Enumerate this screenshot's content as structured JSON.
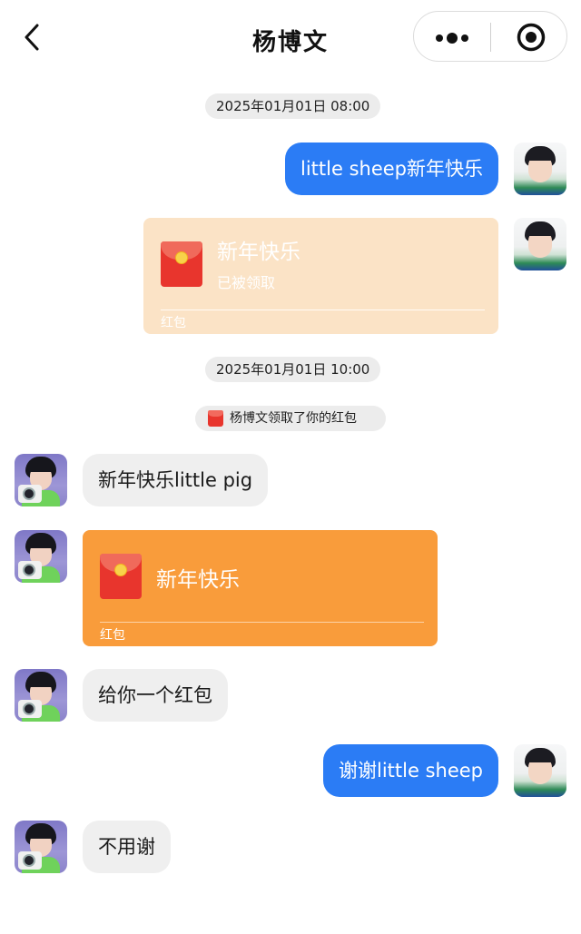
{
  "header": {
    "title": "杨博文",
    "back_icon": "chevron-left-icon",
    "more_icon": "more-dots-icon",
    "close_icon": "target-circle-icon"
  },
  "colors": {
    "outgoing_bubble": "#2b7cf5",
    "incoming_bubble": "#efefef",
    "packet_received": "#fbe3c6",
    "packet_unopened": "#f99c3b",
    "envelope_red": "#e8352d"
  },
  "timestamps": [
    "2025年01月01日 08:00",
    "2025年01月01日 10:00"
  ],
  "notice": {
    "text": "杨博文领取了你的红包",
    "icon": "red-envelope-icon"
  },
  "messages": [
    {
      "side": "right",
      "type": "text",
      "text": "little sheep新年快乐"
    },
    {
      "side": "right",
      "type": "red_packet",
      "title": "新年快乐",
      "status": "已被领取",
      "footer": "红包"
    },
    {
      "side": "left",
      "type": "text",
      "text": "新年快乐little pig"
    },
    {
      "side": "left",
      "type": "red_packet",
      "title": "新年快乐",
      "footer": "红包"
    },
    {
      "side": "left",
      "type": "text",
      "text": "给你一个红包"
    },
    {
      "side": "right",
      "type": "text",
      "text": "谢谢little sheep"
    },
    {
      "side": "left",
      "type": "text",
      "text": "不用谢"
    }
  ]
}
